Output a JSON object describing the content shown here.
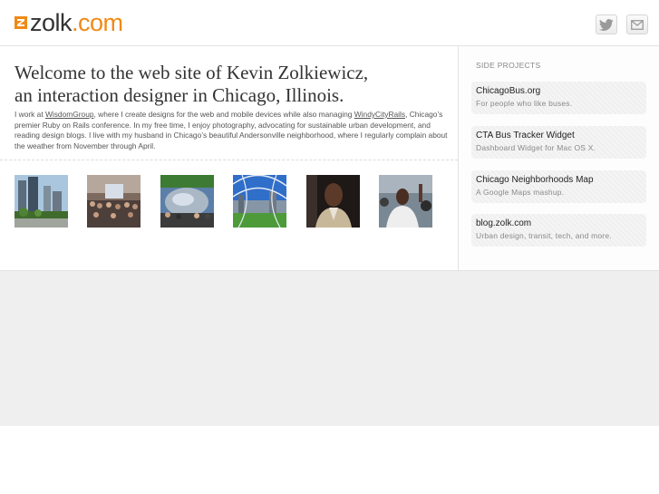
{
  "logo": {
    "name": "zolk",
    "tld": ".com",
    "accent": "#f08a16"
  },
  "header": {
    "twitter_icon": "twitter-bird-icon",
    "mail_icon": "envelope-icon"
  },
  "welcome": {
    "line1": "Welcome to the web site of Kevin Zolkiewicz,",
    "line2": "an interaction designer in Chicago, Illinois."
  },
  "bio": {
    "part1": "I work at ",
    "link1": "WisdomGroup",
    "part2": ", where I create designs for the web and mobile devices while also managing ",
    "link2": "WindyCityRails",
    "part3": ", Chicago’s premier Ruby on Rails conference. In my free time, I enjoy photography, advocating for sustainable urban development, and reading design blogs. I live with my husband in Chicago’s beautiful Andersonville neighborhood, where I regularly complain about the weather from November through April."
  },
  "photos": [
    {
      "subject": "city-park-towers"
    },
    {
      "subject": "conference-crowd"
    },
    {
      "subject": "cloud-gate-crowd"
    },
    {
      "subject": "pavilion-trellis"
    },
    {
      "subject": "portrait-man"
    },
    {
      "subject": "crowd-celebration"
    }
  ],
  "sidebar": {
    "heading": "SIDE PROJECTS",
    "projects": [
      {
        "title": "ChicagoBus.org",
        "desc": "For people who like buses."
      },
      {
        "title": "CTA Bus Tracker Widget",
        "desc": "Dashboard Widget for Mac OS X."
      },
      {
        "title": "Chicago Neighborhoods Map",
        "desc": "A Google Maps mashup."
      },
      {
        "title": "blog.zolk.com",
        "desc": "Urban design, transit, tech, and more."
      }
    ]
  }
}
